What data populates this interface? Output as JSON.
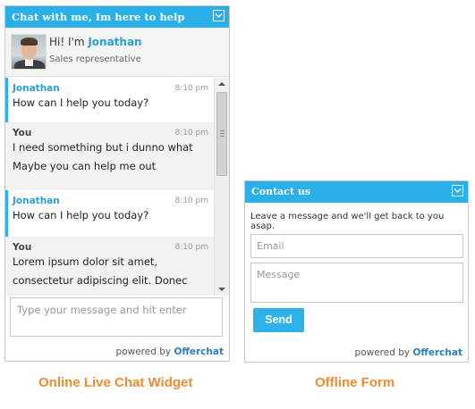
{
  "chat_widget": {
    "header_title": "Chat with me, Im here to help",
    "greeting_prefix": "Hi! I'm ",
    "agent_name": "Jonathan",
    "agent_role": "Sales representative",
    "messages": [
      {
        "sender": "Jonathan",
        "time": "8:10 pm",
        "lines": [
          "How can I help you today?"
        ]
      },
      {
        "sender": "You",
        "time": "8:10 pm",
        "lines": [
          "I need something but i dunno what",
          "Maybe you can help me out"
        ]
      },
      {
        "sender": "Jonathan",
        "time": "8:10 pm",
        "lines": [
          "How can I help you today?"
        ]
      },
      {
        "sender": "You",
        "time": "8:10 pm",
        "lines": [
          "Lorem ipsum dolor sit amet,",
          "consectetur adipiscing elit. Donec"
        ]
      }
    ],
    "input_placeholder": "Type your message and hit enter",
    "powered_by": "powered by ",
    "brand": "Offerchat"
  },
  "offline_form": {
    "header_title": "Contact us",
    "description": "Leave a message and we'll get back to you asap.",
    "email_placeholder": "Email",
    "message_placeholder": "Message",
    "send_label": "Send",
    "powered_by": "powered by ",
    "brand": "Offerchat"
  },
  "captions": {
    "left": "Online Live Chat Widget",
    "right": "Offline Form"
  },
  "colors": {
    "accent": "#29b0e8",
    "caption": "#f58a2e",
    "brand": "#2a7fc0"
  },
  "icons": {
    "collapse": "chevron-down-icon",
    "avatar": "agent-photo"
  }
}
